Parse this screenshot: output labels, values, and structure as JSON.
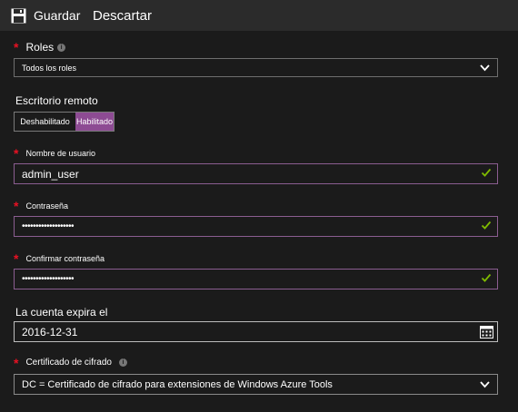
{
  "toolbar": {
    "save_label": "Guardar",
    "discard_label": "Descartar",
    "save_icon": "floppy-disk-icon"
  },
  "roles": {
    "label": "Roles",
    "required": "*",
    "selected": "Todos los roles"
  },
  "remote_desktop": {
    "label": "Escritorio remoto",
    "off_label": "Deshabilitado",
    "on_label": "Habilitado",
    "state": "Habilitado"
  },
  "username": {
    "label": "Nombre de usuario",
    "required": "*",
    "value": "admin_user"
  },
  "password": {
    "label": "Contraseña",
    "required": "*",
    "value": "•••••••••••••••••••"
  },
  "confirm_password": {
    "label": "Confirmar contraseña",
    "required": "*",
    "value": "•••••••••••••••••••"
  },
  "expiry": {
    "label": "La cuenta expira el",
    "value": "2016-12-31"
  },
  "certificate": {
    "label": "Certificado de cifrado",
    "required": "*",
    "selected": "DC = Certificado de cifrado para extensiones de Windows Azure Tools"
  },
  "colors": {
    "background": "#1b1b1b",
    "toolbar": "#2b2b2b",
    "accent": "#8d4b93",
    "required": "#e81123",
    "valid": "#7fba00"
  }
}
